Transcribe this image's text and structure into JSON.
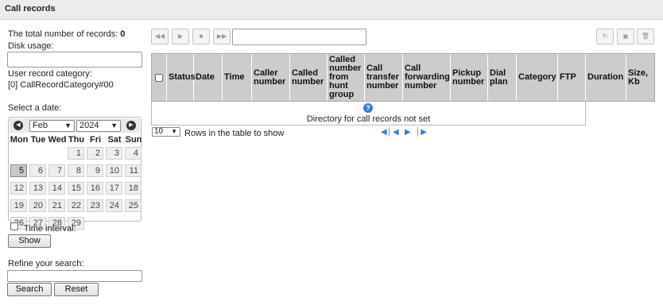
{
  "header": {
    "title": "Call records"
  },
  "left": {
    "total_label": "The total number of records:",
    "total_value": "0",
    "disk_usage_label": "Disk usage:",
    "disk_usage_value": "",
    "user_category_label": "User record category:",
    "user_category_value": "[0] CallRecordCategory#00",
    "select_date_label": "Select a date:",
    "time_interval_label": "Time interval:",
    "show_button": "Show",
    "refine_label": "Refine your search:",
    "search_value": "",
    "search_button": "Search",
    "reset_button": "Reset"
  },
  "calendar": {
    "month": "Feb",
    "year": "2024",
    "selected_day": 5,
    "weekdays": [
      "Mon",
      "Tue",
      "Wed",
      "Thu",
      "Fri",
      "Sat",
      "Sun"
    ],
    "weeks": [
      [
        "",
        "",
        "",
        "1",
        "2",
        "3",
        "4"
      ],
      [
        "5",
        "6",
        "7",
        "8",
        "9",
        "10",
        "11"
      ],
      [
        "12",
        "13",
        "14",
        "15",
        "16",
        "17",
        "18"
      ],
      [
        "19",
        "20",
        "21",
        "22",
        "23",
        "24",
        "25"
      ],
      [
        "26",
        "27",
        "28",
        "29",
        "",
        "",
        ""
      ]
    ]
  },
  "toolbar": {
    "buttons": [
      "rewind-icon",
      "play-icon",
      "stop-icon",
      "fast-forward-icon"
    ],
    "path_value": "",
    "right_buttons": [
      "refresh-icon",
      "save-icon",
      "delete-icon"
    ]
  },
  "table": {
    "columns": [
      "Status",
      "Date",
      "Time",
      "Caller number",
      "Called number",
      "Called number from hunt group",
      "Call transfer number",
      "Call forwarding number",
      "Pickup number",
      "Dial plan",
      "Category",
      "FTP",
      "Duration",
      "Size, Kb"
    ],
    "empty_icon": "?",
    "empty_message": "Directory for call records not set",
    "rows_per_page": "10",
    "rows_label": "Rows in the table to show"
  },
  "colors": {
    "header_bg": "#ececec",
    "table_header_bg": "#cccccc",
    "pager_blue": "#3a7bd5"
  }
}
